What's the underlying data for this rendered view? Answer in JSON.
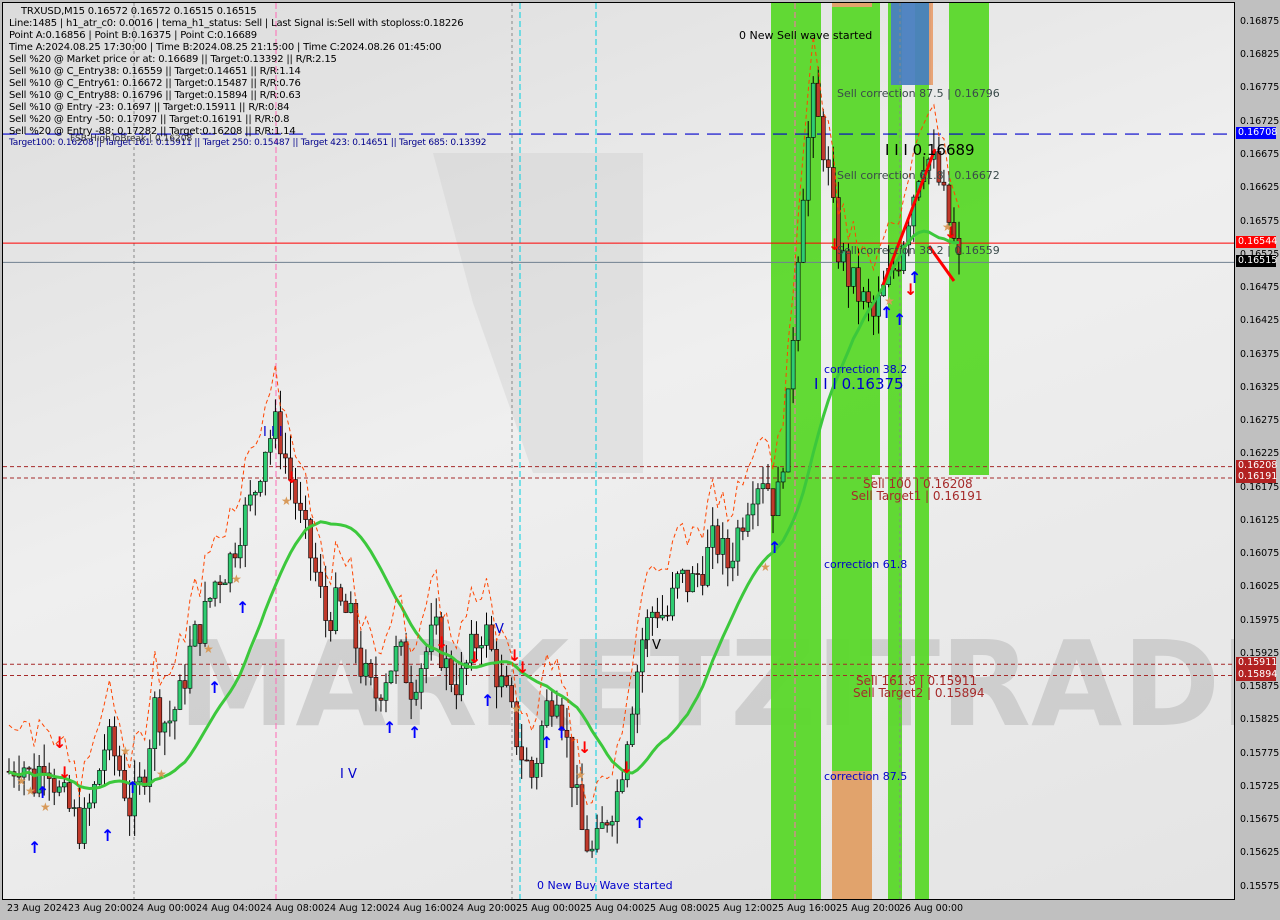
{
  "header": {
    "symbol_line": "TRXUSD,M15  0.16572 0.16572 0.16515 0.16515",
    "info_lines": [
      "Line:1485 | h1_atr_c0: 0.0016 | tema_h1_status: Sell | Last Signal is:Sell with stoploss:0.18226",
      "Point A:0.16856 | Point B:0.16375 | Point C:0.16689",
      "Time A:2024.08.25 17:30:00 | Time B:2024.08.25 21:15:00 | Time C:2024.08.26 01:45:00",
      "Sell %20 @ Market price or at: 0.16689 || Target:0.13392 || R/R:2.15",
      "Sell %10 @ C_Entry38: 0.16559 || Target:0.14651 || R/R:1.14",
      "Sell %10 @ C_Entry61: 0.16672 || Target:0.15487 || R/R:0.76",
      "Sell %10 @ C_Entry88: 0.16796 || Target:0.15894 || R/R:0.63",
      "Sell %10 @ Entry -23: 0.1697 || Target:0.15911 || R/R:0.84",
      "Sell %20 @ Entry -50: 0.17097 || Target:0.16191 || R/R:0.8",
      "Sell %20 @ Entry -88: 0.17282 || Target:0.16208 || R/R:1.14"
    ],
    "targets_line": "Target100: 0.16208 || Target 161: 0.15911 || Target 250: 0.15487 || Target 423: 0.14651 || Target 685: 0.13392",
    "fsb_label": "FSB-HighToBreak | 0.16208"
  },
  "annotations": {
    "new_sell_wave": "0 New Sell wave started",
    "new_buy_wave": "0 New Buy Wave started",
    "sell_corr_875": "Sell correction 87.5 | 0.16796",
    "sell_corr_618": "Sell correction 61.8 | 0.16672",
    "sell_corr_382": "Sell correction 38.2 | 0.16559",
    "point_c": "I I I 0.16689",
    "correction_382": "correction 38.2",
    "point_b": "I I I 0.16375",
    "sell_100": "Sell 100 | 0.16208",
    "sell_target1": "Sell Target1 | 0.16191",
    "correction_618": "correction 61.8",
    "sell_1618": "Sell 161.8 | 0.15911",
    "sell_target2": "Sell Target2 | 0.15894",
    "correction_875": "correction 87.5",
    "wave_iii": "I I I",
    "wave_iv": "I V",
    "wave_v": "V",
    "wave_iv2": "I V",
    "watermark": "MARKETZITRADE"
  },
  "price_tags": [
    {
      "value": "0.16708",
      "color": "#0000ff"
    },
    {
      "value": "0.16544",
      "color": "#ff0000"
    },
    {
      "value": "0.16515",
      "color": "#000000"
    },
    {
      "value": "0.16208",
      "color": "#b22222"
    },
    {
      "value": "0.16191",
      "color": "#b22222"
    },
    {
      "value": "0.15911",
      "color": "#b22222"
    },
    {
      "value": "0.15894",
      "color": "#b22222"
    }
  ],
  "chart_data": {
    "type": "candlestick",
    "title": "TRXUSD,M15",
    "ylim": [
      0.15555,
      0.16905
    ],
    "yticks": [
      "0.16875",
      "0.16825",
      "0.16775",
      "0.16725",
      "0.16675",
      "0.16625",
      "0.16575",
      "0.16525",
      "0.16475",
      "0.16425",
      "0.16375",
      "0.16325",
      "0.16275",
      "0.16225",
      "0.16175",
      "0.16125",
      "0.16075",
      "0.16025",
      "0.15975",
      "0.15925",
      "0.15875",
      "0.15825",
      "0.15775",
      "0.15725",
      "0.15675",
      "0.15625",
      "0.15575"
    ],
    "xticks": [
      "23 Aug 2024",
      "23 Aug 20:00",
      "24 Aug 00:00",
      "24 Aug 04:00",
      "24 Aug 08:00",
      "24 Aug 12:00",
      "24 Aug 16:00",
      "24 Aug 20:00",
      "25 Aug 00:00",
      "25 Aug 04:00",
      "25 Aug 08:00",
      "25 Aug 12:00",
      "25 Aug 16:00",
      "25 Aug 20:00",
      "26 Aug 00:00"
    ],
    "ohlc_last": {
      "open": 0.16572,
      "high": 0.16572,
      "low": 0.16515,
      "close": 0.16515
    },
    "levels": {
      "target_line": 0.16708,
      "bid": 0.16544,
      "last": 0.16515,
      "sell_100": 0.16208,
      "sell_target1": 0.16191,
      "sell_1618": 0.15911,
      "sell_target2": 0.15894,
      "point_a": 0.16856,
      "point_b": 0.16375,
      "point_c": 0.16689
    },
    "close_path": [
      0.1575,
      0.1577,
      0.1573,
      0.1578,
      0.1572,
      0.1569,
      0.1566,
      0.1572,
      0.158,
      0.1576,
      0.1569,
      0.1574,
      0.1585,
      0.1582,
      0.1586,
      0.1594,
      0.1598,
      0.1604,
      0.1606,
      0.1612,
      0.1616,
      0.1624,
      0.1627,
      0.162,
      0.1612,
      0.1606,
      0.1598,
      0.16,
      0.1598,
      0.159,
      0.1586,
      0.159,
      0.1593,
      0.1588,
      0.1592,
      0.1596,
      0.159,
      0.1588,
      0.1593,
      0.1597,
      0.159,
      0.1585,
      0.1578,
      0.1574,
      0.1584,
      0.1588,
      0.1577,
      0.1566,
      0.1562,
      0.1568,
      0.1572,
      0.1584,
      0.1595,
      0.16,
      0.1598,
      0.1604,
      0.1603,
      0.1606,
      0.161,
      0.1606,
      0.1612,
      0.1618,
      0.162,
      0.1614,
      0.163,
      0.166,
      0.1676,
      0.1668,
      0.1654,
      0.1649,
      0.1646,
      0.1643,
      0.1648,
      0.1652,
      0.166,
      0.1668,
      0.1666,
      0.1659,
      0.1651
    ]
  }
}
